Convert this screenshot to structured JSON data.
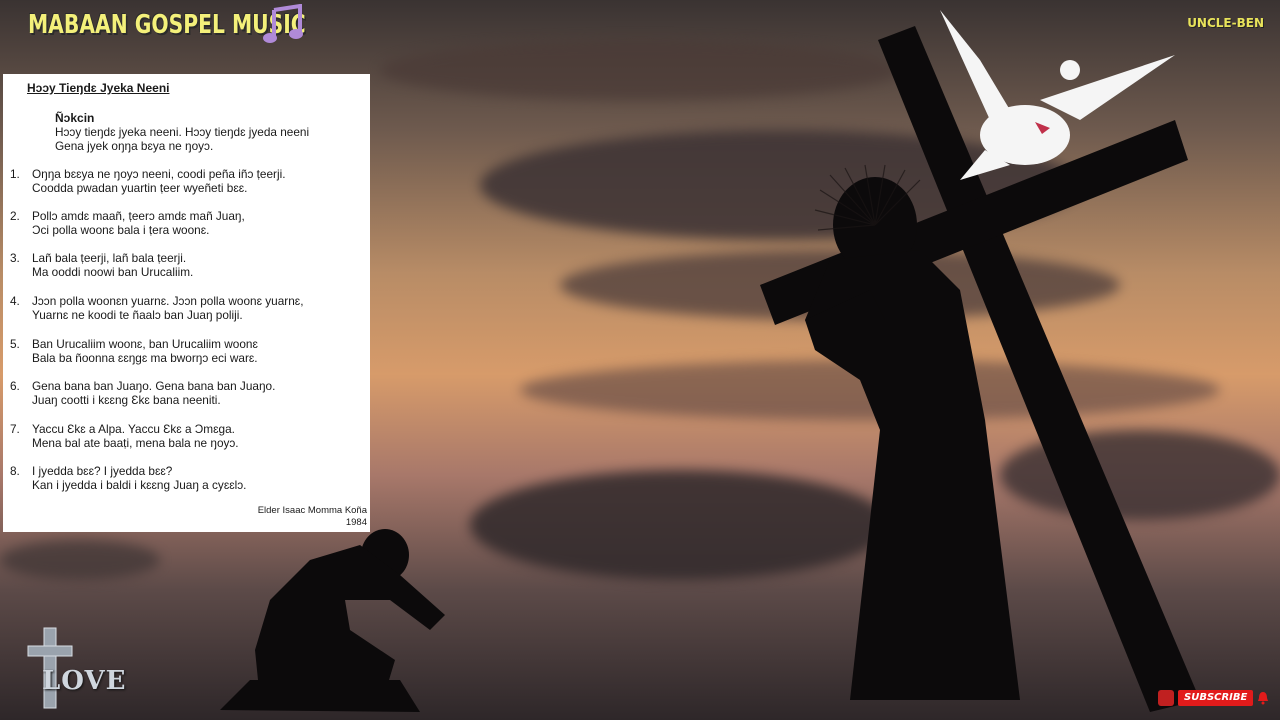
{
  "header": {
    "channel_title": "MABAAN GOSPEL MUSIC",
    "watermark": "UNCLE-BEN"
  },
  "icons": {
    "music_note": "music-note-icon",
    "dove": "dove-icon",
    "cross": "cross-icon",
    "love_logo": "love-cross-logo-icon",
    "bell": "bell-icon"
  },
  "lyrics": {
    "title": "Hɔɔy Tieŋdɛ Jyeka Neeni",
    "chorus_heading": "Ñɔkcin",
    "chorus_lines": [
      "Hɔɔy tieŋdɛ jyeka neeni.  Hɔɔy tieŋdɛ jyeda neeni",
      "Gena jyek oŋŋa bɛya ne ŋoyɔ."
    ],
    "verses": [
      {
        "num": "1.",
        "lines": [
          "Oŋŋa bɛɛya ne ŋoyɔ neeni, coodi peña iñɔ ṭeerji.",
          "Coodda pwadan yuartin ṭeer wyeñeti bɛɛ."
        ]
      },
      {
        "num": "2.",
        "lines": [
          "Pollɔ amdɛ maañ, ṭeerɔ amdɛ mañ Juaŋ,",
          "Ɔci polla woonɛ bala i ṭera woonɛ."
        ]
      },
      {
        "num": "3.",
        "lines": [
          "Lañ bala ṭeerji, lañ bala ṭeerji.",
          "Ma ooddi noowi ban Urucaliim."
        ]
      },
      {
        "num": "4.",
        "lines": [
          "Jɔɔn polla woonɛn yuarnɛ.  Jɔɔn polla woonɛ yuarnɛ,",
          "Yuarnɛ ne koodi te ñaalɔ ban Juaŋ poliji."
        ]
      },
      {
        "num": "5.",
        "lines": [
          "Ban Urucaliim woonɛ, ban Urucaliim woonɛ",
          "Bala ba ñoonna ɛɛŋgɛ ma bworŋɔ eci warɛ."
        ]
      },
      {
        "num": "6.",
        "lines": [
          "Gena bana ban Juaŋo.  Gena bana ban Juaŋo.",
          "Juaŋ cootti i kɛɛng Ɛkɛ bana neeniti."
        ]
      },
      {
        "num": "7.",
        "lines": [
          "Yaccu Ɛkɛ a Alpa.  Yaccu Ɛkɛ a Ɔmɛga.",
          "Mena bal ate baaṭi, mena bala ne ŋoyɔ."
        ]
      },
      {
        "num": "8.",
        "lines": [
          "I jyedda bɛɛ?  I jyedda bɛɛ?",
          "Kan i jyedda i baldi i kɛɛng Juaŋ a cyɛɛlɔ."
        ]
      }
    ],
    "author": "Elder Isaac Momma Koña",
    "year": "1984"
  },
  "footer": {
    "love_text": "LOVE",
    "subscribe_label": "SUBSCRIBE"
  },
  "colors": {
    "title_yellow": "#f4f07a",
    "subscribe_red": "#e21b1b"
  }
}
